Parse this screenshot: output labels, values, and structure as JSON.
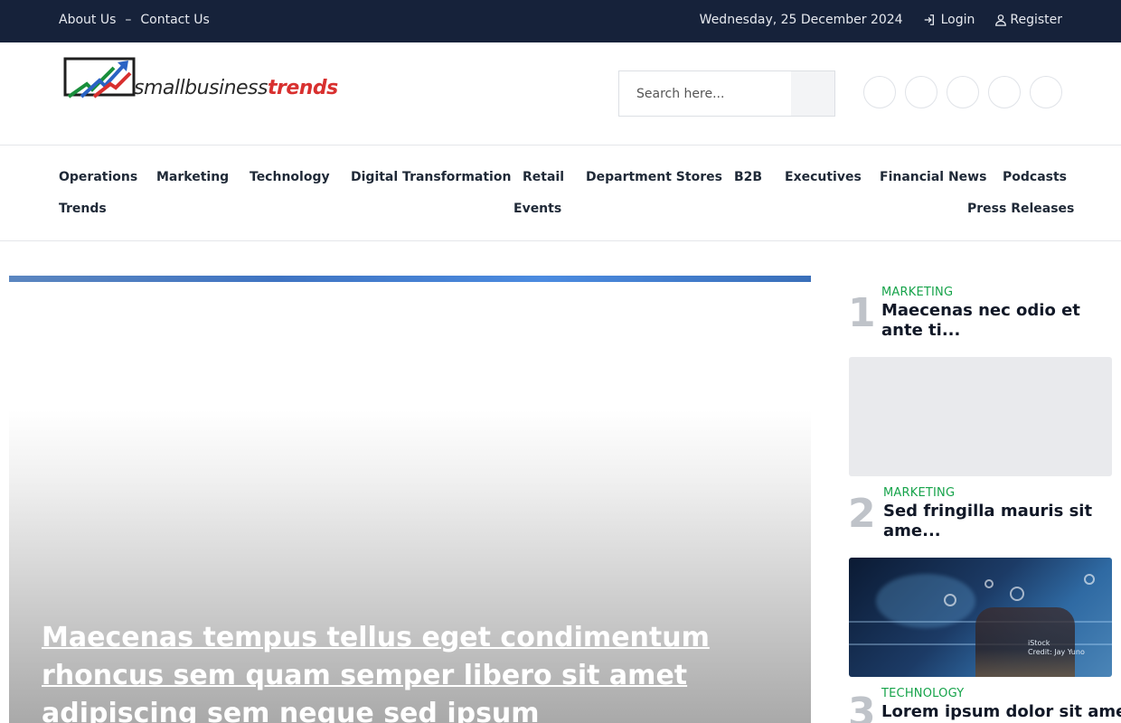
{
  "topbar": {
    "links": [
      "About Us",
      "Contact Us"
    ],
    "separator": "–",
    "date": "Wednesday, 25 December 2024",
    "login_label": "Login",
    "register_label": "Register"
  },
  "header": {
    "logo_text_main": "smallbusiness",
    "logo_text_accent": "trends",
    "search_placeholder": "Search here..."
  },
  "nav": {
    "items": [
      "Operations",
      "Marketing",
      "Technology",
      "Digital Transformation",
      "Retail",
      "Department Stores",
      "B2B",
      "Executives",
      "Financial News",
      "Podcasts",
      "Trends",
      "Events",
      "Press Releases"
    ]
  },
  "hero": {
    "title": "Maecenas tempus tellus eget condimentum rhoncus sem quam semper libero sit amet adipiscing sem neque sed ipsum"
  },
  "sidebar": {
    "items": [
      {
        "number": "1",
        "category": "MARKETING",
        "title": "Maecenas nec odio et ante ti..."
      },
      {
        "number": "2",
        "category": "MARKETING",
        "title": "Sed fringilla mauris sit ame..."
      },
      {
        "number": "3",
        "category": "TECHNOLOGY",
        "title": "Lorem ipsum dolor sit amet"
      }
    ],
    "image_credit": "iStock\nCredit: Jay Yuno"
  },
  "colors": {
    "topbar_bg": "#16223a",
    "category_green": "#16a34a",
    "logo_red": "#d8302f"
  }
}
